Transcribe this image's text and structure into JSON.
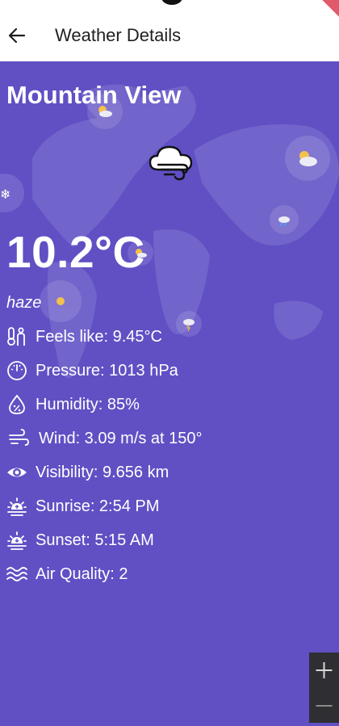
{
  "app_bar": {
    "title": "Weather Details",
    "back_icon": "arrow-left-icon"
  },
  "weather": {
    "city": "Mountain View",
    "temperature": "10.2°C",
    "description": "haze",
    "condition_icon": "wind-cloud-icon"
  },
  "details": [
    {
      "icon": "thermometer-person-icon",
      "label": "Feels like: 9.45°C"
    },
    {
      "icon": "gauge-icon",
      "label": "Pressure: 1013 hPa"
    },
    {
      "icon": "humidity-drop-icon",
      "label": "Humidity: 85%"
    },
    {
      "icon": "wind-icon",
      "label": "Wind: 3.09 m/s at 150°"
    },
    {
      "icon": "eye-icon",
      "label": "Visibility: 9.656 km"
    },
    {
      "icon": "sunrise-icon",
      "label": "Sunrise: 2:54 PM"
    },
    {
      "icon": "sunset-icon",
      "label": "Sunset: 5:15 AM"
    },
    {
      "icon": "air-waves-icon",
      "label": "Air Quality: 2"
    }
  ],
  "map_controls": {
    "zoom_in_icon": "plus-icon",
    "zoom_out_icon": "minus-icon"
  },
  "colors": {
    "background": "#6050c4",
    "app_bar": "#ffffff",
    "text": "#ffffff"
  }
}
